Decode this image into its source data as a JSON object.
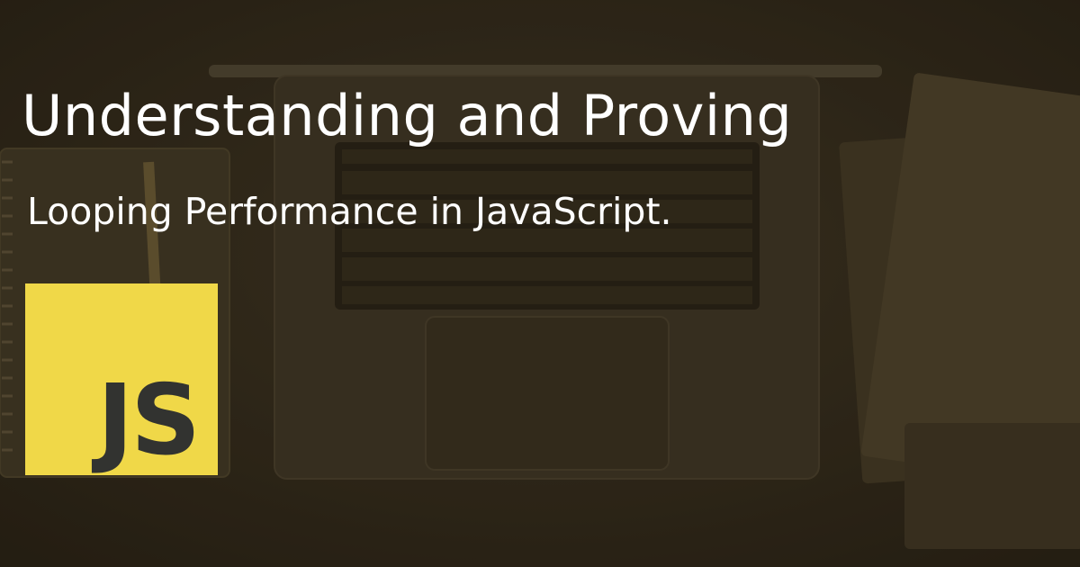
{
  "hero": {
    "title": "Understanding and Proving",
    "subtitle": "Looping Performance in JavaScript.",
    "logo_text": "JS"
  },
  "colors": {
    "overlay": "#2b2416",
    "text": "#ffffff",
    "logo_bg": "#f0d848",
    "logo_text": "#323330"
  },
  "icons": {
    "background": "laptop-desk-photo-icon",
    "logo": "javascript-logo-icon"
  }
}
